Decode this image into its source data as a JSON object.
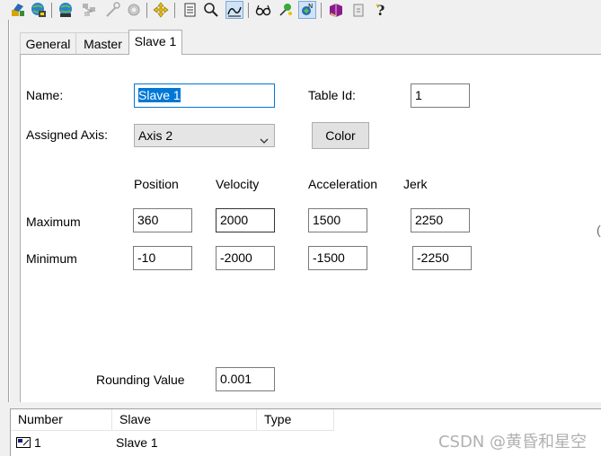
{
  "toolbar": {
    "buttons": [
      {
        "icon": "tools-icon"
      },
      {
        "icon": "globe-config-icon"
      },
      {
        "icon": "globe-network-icon"
      },
      {
        "icon": "network-disabled-icon"
      },
      {
        "icon": "wand-disabled-icon"
      },
      {
        "icon": "gear-disabled-icon"
      },
      {
        "icon": "move-icon"
      },
      {
        "icon": "document-list-icon"
      },
      {
        "icon": "magnifier-icon"
      },
      {
        "icon": "cam-profile-icon"
      },
      {
        "icon": "glasses-icon"
      },
      {
        "icon": "pin-icon"
      },
      {
        "icon": "nc-icon"
      },
      {
        "icon": "book-icon"
      },
      {
        "icon": "page-icon"
      },
      {
        "icon": "help-icon"
      }
    ]
  },
  "tabs": [
    {
      "label": "General",
      "active": false
    },
    {
      "label": "Master",
      "active": false
    },
    {
      "label": "Slave 1",
      "active": true
    }
  ],
  "form": {
    "name_label": "Name:",
    "name_value": "Slave 1",
    "table_id_label": "Table Id:",
    "table_id_value": "1",
    "assigned_axis_label": "Assigned Axis:",
    "assigned_axis_value": "Axis 2",
    "color_button_label": "Color"
  },
  "limits": {
    "columns": [
      "Position",
      "Velocity",
      "Acceleration",
      "Jerk"
    ],
    "rows": [
      {
        "label": "Maximum",
        "values": [
          "360",
          "2000",
          "1500",
          "2250"
        ]
      },
      {
        "label": "Minimum",
        "values": [
          "-10",
          "-2000",
          "-1500",
          "-2250"
        ]
      }
    ]
  },
  "rounding": {
    "label": "Rounding Value",
    "value": "0.001"
  },
  "list": {
    "headers": [
      "Number",
      "Slave",
      "Type"
    ],
    "rows": [
      {
        "number": "1",
        "slave": "Slave 1",
        "type": ""
      }
    ]
  },
  "watermark": "CSDN @黄昏和星空",
  "colors": {
    "selection": "#0078d7",
    "panel": "#f0f0f0"
  }
}
